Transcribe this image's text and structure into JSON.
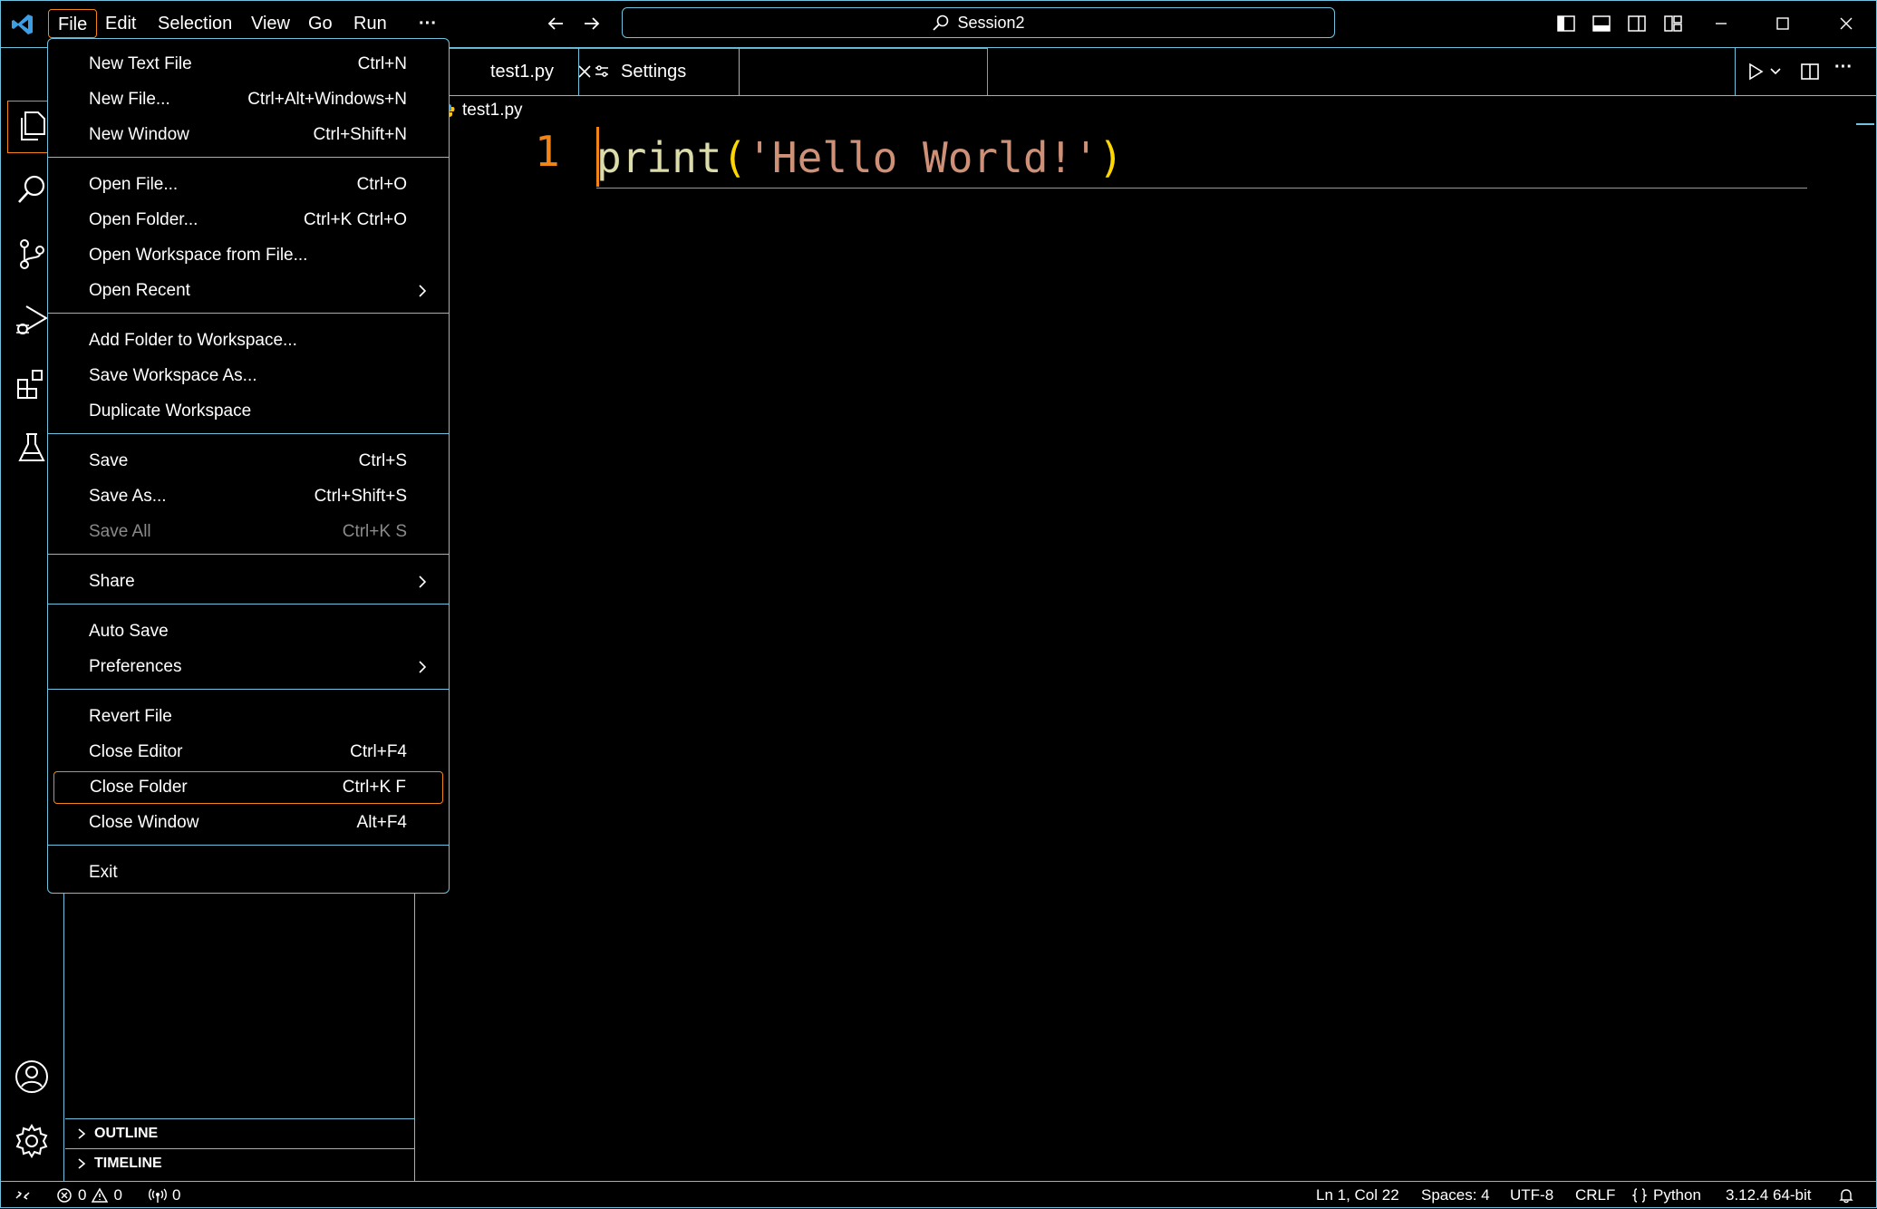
{
  "titlebar": {
    "menus": [
      "File",
      "Edit",
      "Selection",
      "View",
      "Go",
      "Run"
    ],
    "more": "···",
    "search_text": "Session2"
  },
  "tabs": [
    {
      "label": "test1.py"
    },
    {
      "label": "Settings"
    }
  ],
  "breadcrumb": "test1.py",
  "editor": {
    "line_number": "1",
    "code_fn": "print",
    "code_open": "(",
    "code_str": "'Hello World!'",
    "code_close": ")"
  },
  "file_menu": {
    "items": [
      {
        "label": "New Text File",
        "shortcut": "Ctrl+N"
      },
      {
        "label": "New File...",
        "shortcut": "Ctrl+Alt+Windows+N"
      },
      {
        "label": "New Window",
        "shortcut": "Ctrl+Shift+N"
      },
      {
        "label": "Open File...",
        "shortcut": "Ctrl+O"
      },
      {
        "label": "Open Folder...",
        "shortcut": "Ctrl+K Ctrl+O"
      },
      {
        "label": "Open Workspace from File...",
        "shortcut": ""
      },
      {
        "label": "Open Recent",
        "shortcut": ""
      },
      {
        "label": "Add Folder to Workspace...",
        "shortcut": ""
      },
      {
        "label": "Save Workspace As...",
        "shortcut": ""
      },
      {
        "label": "Duplicate Workspace",
        "shortcut": ""
      },
      {
        "label": "Save",
        "shortcut": "Ctrl+S"
      },
      {
        "label": "Save As...",
        "shortcut": "Ctrl+Shift+S"
      },
      {
        "label": "Save All",
        "shortcut": "Ctrl+K S"
      },
      {
        "label": "Share",
        "shortcut": ""
      },
      {
        "label": "Auto Save",
        "shortcut": ""
      },
      {
        "label": "Preferences",
        "shortcut": ""
      },
      {
        "label": "Revert File",
        "shortcut": ""
      },
      {
        "label": "Close Editor",
        "shortcut": "Ctrl+F4"
      },
      {
        "label": "Close Folder",
        "shortcut": "Ctrl+K F"
      },
      {
        "label": "Close Window",
        "shortcut": "Alt+F4"
      },
      {
        "label": "Exit",
        "shortcut": ""
      }
    ]
  },
  "sidebar": {
    "outline": "OUTLINE",
    "timeline": "TIMELINE"
  },
  "statusbar": {
    "errors": "0",
    "warnings": "0",
    "ports": "0",
    "position": "Ln 1, Col 22",
    "spaces": "Spaces: 4",
    "encoding": "UTF-8",
    "eol": "CRLF",
    "language": "Python",
    "interpreter": "3.12.4 64-bit"
  },
  "colors": {
    "border": "#6fc3df",
    "focus": "#f38518",
    "function": "#dcdcaa",
    "bracket": "#ffd700",
    "string": "#ce9178"
  }
}
